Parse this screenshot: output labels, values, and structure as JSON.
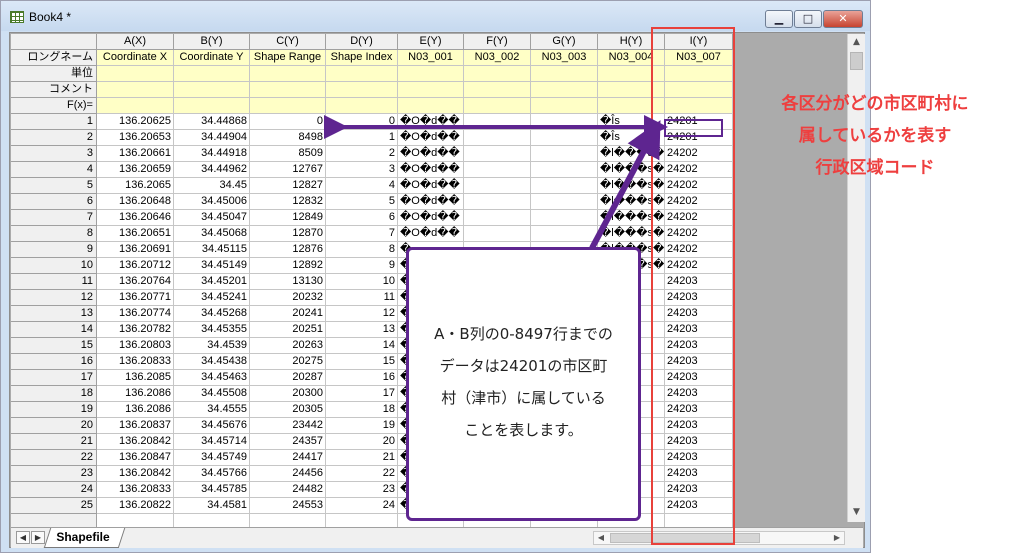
{
  "window": {
    "title": "Book4 *",
    "minimize_glyph": "▁",
    "maximize_glyph": "□",
    "close_glyph": "✕"
  },
  "columns": [
    "A(X)",
    "B(Y)",
    "C(Y)",
    "D(Y)",
    "E(Y)",
    "F(Y)",
    "G(Y)",
    "H(Y)",
    "I(Y)"
  ],
  "meta_rows": [
    {
      "label": "ロングネーム",
      "values": [
        "Coordinate X",
        "Coordinate Y",
        "Shape Range",
        "Shape Index",
        "N03_001",
        "N03_002",
        "N03_003",
        "N03_004",
        "N03_007"
      ]
    },
    {
      "label": "単位",
      "values": [
        "",
        "",
        "",
        "",
        "",
        "",
        "",
        "",
        ""
      ]
    },
    {
      "label": "コメント",
      "values": [
        "",
        "",
        "",
        "",
        "",
        "",
        "",
        "",
        ""
      ]
    },
    {
      "label": "F(x)=",
      "values": [
        "",
        "",
        "",
        "",
        "",
        "",
        "",
        "",
        ""
      ]
    }
  ],
  "rows": [
    [
      "1",
      "136.20625",
      "34.44868",
      "0",
      "0",
      "�O�d��",
      "",
      "",
      "�Îs",
      "24201"
    ],
    [
      "2",
      "136.20653",
      "34.44904",
      "8498",
      "1",
      "�O�d��",
      "",
      "",
      "�Îs",
      "24201"
    ],
    [
      "3",
      "136.20661",
      "34.44918",
      "8509",
      "2",
      "�O�d��",
      "",
      "",
      "�l���s�s",
      "24202"
    ],
    [
      "4",
      "136.20659",
      "34.44962",
      "12767",
      "3",
      "�O�d��",
      "",
      "",
      "�l���s�s",
      "24202"
    ],
    [
      "5",
      "136.2065",
      "34.45",
      "12827",
      "4",
      "�O�d��",
      "",
      "",
      "�l���s�s",
      "24202"
    ],
    [
      "6",
      "136.20648",
      "34.45006",
      "12832",
      "5",
      "�O�d��",
      "",
      "",
      "�l���s�s",
      "24202"
    ],
    [
      "7",
      "136.20646",
      "34.45047",
      "12849",
      "6",
      "�O�d��",
      "",
      "",
      "�l���s�s",
      "24202"
    ],
    [
      "8",
      "136.20651",
      "34.45068",
      "12870",
      "7",
      "�O�d��",
      "",
      "",
      "�l���s�s",
      "24202"
    ],
    [
      "9",
      "136.20691",
      "34.45115",
      "12876",
      "8",
      "�",
      "",
      "",
      "�l���s�s",
      "24202"
    ],
    [
      "10",
      "136.20712",
      "34.45149",
      "12892",
      "9",
      "�",
      "",
      "",
      "�l���s�s",
      "24202"
    ],
    [
      "11",
      "136.20764",
      "34.45201",
      "13130",
      "10",
      "�",
      "",
      "",
      "",
      "24203"
    ],
    [
      "12",
      "136.20771",
      "34.45241",
      "20232",
      "11",
      "�",
      "",
      "",
      "",
      "24203"
    ],
    [
      "13",
      "136.20774",
      "34.45268",
      "20241",
      "12",
      "�",
      "",
      "",
      "",
      "24203"
    ],
    [
      "14",
      "136.20782",
      "34.45355",
      "20251",
      "13",
      "�",
      "",
      "",
      "",
      "24203"
    ],
    [
      "15",
      "136.20803",
      "34.4539",
      "20263",
      "14",
      "�",
      "",
      "",
      "",
      "24203"
    ],
    [
      "16",
      "136.20833",
      "34.45438",
      "20275",
      "15",
      "�",
      "",
      "",
      "",
      "24203"
    ],
    [
      "17",
      "136.2085",
      "34.45463",
      "20287",
      "16",
      "�",
      "",
      "",
      "",
      "24203"
    ],
    [
      "18",
      "136.2086",
      "34.45508",
      "20300",
      "17",
      "�",
      "",
      "",
      "",
      "24203"
    ],
    [
      "19",
      "136.2086",
      "34.4555",
      "20305",
      "18",
      "�",
      "",
      "",
      "",
      "24203"
    ],
    [
      "20",
      "136.20837",
      "34.45676",
      "23442",
      "19",
      "�",
      "",
      "",
      "",
      "24203"
    ],
    [
      "21",
      "136.20842",
      "34.45714",
      "24357",
      "20",
      "�",
      "",
      "",
      "",
      "24203"
    ],
    [
      "22",
      "136.20847",
      "34.45749",
      "24417",
      "21",
      "�",
      "",
      "",
      "",
      "24203"
    ],
    [
      "23",
      "136.20842",
      "34.45766",
      "24456",
      "22",
      "�",
      "",
      "",
      "",
      "24203"
    ],
    [
      "24",
      "136.20833",
      "34.45785",
      "24482",
      "23",
      "�",
      "",
      "",
      "",
      "24203"
    ],
    [
      "25",
      "136.20822",
      "34.4581",
      "24553",
      "24",
      "�",
      "",
      "",
      "",
      "24203"
    ]
  ],
  "sheet_tab": "Shapefile",
  "nav": {
    "prev": "◀",
    "next": "▶"
  },
  "scroll": {
    "up": "▲",
    "down": "▼",
    "left": "◀",
    "right": "▶"
  },
  "annotations": {
    "callout_lines": [
      "A・B列の0-8497行までの",
      "データは24201の市区町",
      "村（津市）に属している",
      "ことを表します。"
    ],
    "right_note_lines": [
      "各区分がどの市区町村に",
      "属しているかを表す",
      "行政区域コード"
    ],
    "highlight_color": "#e8413b",
    "accent_color": "#5e2590"
  }
}
